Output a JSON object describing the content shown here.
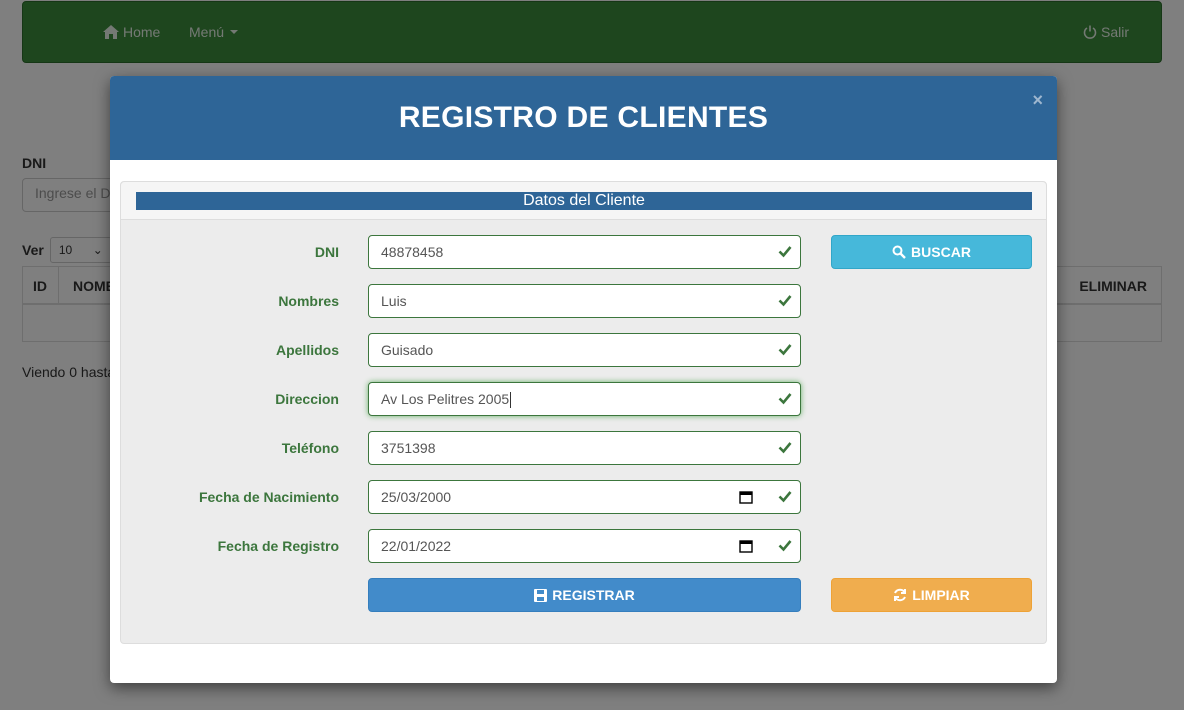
{
  "navbar": {
    "home_label": "Home",
    "menu_label": "Menú",
    "salir_label": "Salir",
    "color": "#3c8c3c"
  },
  "background": {
    "dni_label": "DNI",
    "dni_placeholder": "Ingrese el D",
    "ver_label": "Ver",
    "page_size": "10",
    "columns": [
      "ID",
      "NOMB",
      "ELIMINAR"
    ],
    "footer_text": "Viendo 0 hasta"
  },
  "modal": {
    "title": "REGISTRO DE CLIENTES",
    "close": "×",
    "panel_title": "Datos del Cliente",
    "header_color": "#2e6597",
    "fields": [
      {
        "label": "DNI",
        "value": "48878458"
      },
      {
        "label": "Nombres",
        "value": "Luis"
      },
      {
        "label": "Apellidos",
        "value": "Guisado"
      },
      {
        "label": "Direccion",
        "value": "Av Los Pelitres 2005"
      },
      {
        "label": "Teléfono",
        "value": "3751398"
      },
      {
        "label": "Fecha de Nacimiento",
        "value": "25/03/2000"
      },
      {
        "label": "Fecha de Registro",
        "value": "22/01/2022"
      }
    ],
    "buttons": {
      "buscar": "BUSCAR",
      "registrar": "REGISTRAR",
      "limpiar": "LIMPIAR"
    }
  }
}
